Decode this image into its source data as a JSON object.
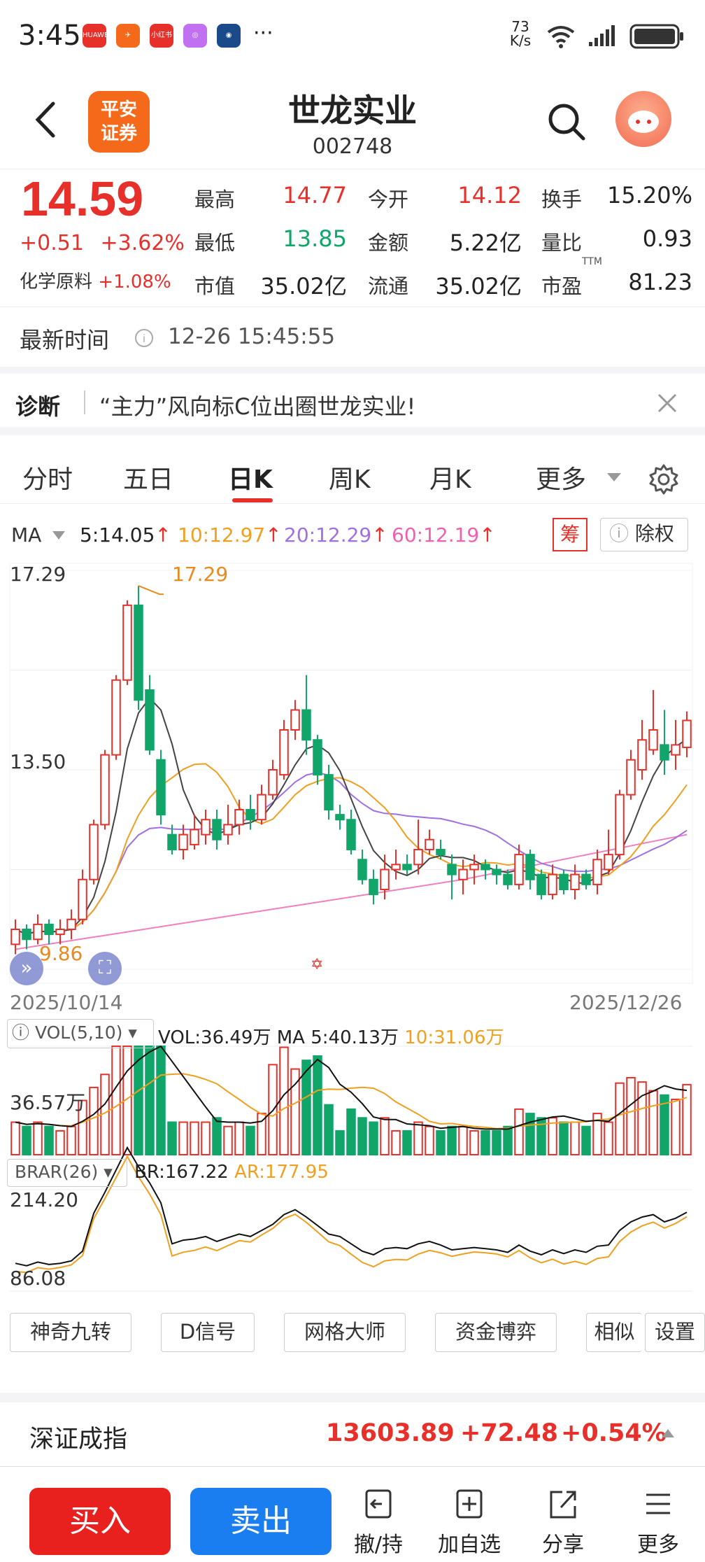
{
  "status_bar": {
    "time": "3:45",
    "net_speed": "73",
    "net_unit": "K/s",
    "app_icons": [
      "HUAWEI",
      "",
      "小红书",
      "",
      "",
      "···"
    ]
  },
  "header": {
    "back_icon": "chevron-left-icon",
    "broker_logo": [
      "平安",
      "证券"
    ],
    "stock_name": "世龙实业",
    "stock_code": "002748",
    "search_icon": "search-icon"
  },
  "quote": {
    "price": "14.59",
    "change": "+0.51",
    "change_pct": "+3.62%",
    "sector": "化学原料",
    "sector_pct": "+1.08%",
    "fields": [
      {
        "label": "最高",
        "value": "14.77",
        "color": "red"
      },
      {
        "label": "今开",
        "value": "14.12",
        "color": "red"
      },
      {
        "label": "换手",
        "value": "15.20%",
        "color": "black"
      },
      {
        "label": "最低",
        "value": "13.85",
        "color": "green"
      },
      {
        "label": "金额",
        "value": "5.22亿",
        "color": "black"
      },
      {
        "label": "量比",
        "value": "0.93",
        "color": "black"
      },
      {
        "label": "市值",
        "value": "35.02亿",
        "color": "black"
      },
      {
        "label": "流通",
        "value": "35.02亿",
        "color": "black"
      },
      {
        "label": "市盈",
        "value": "81.23",
        "color": "black"
      }
    ],
    "ttm": "TTM"
  },
  "latest_time": {
    "label": "最新时间",
    "value": "12-26 15:45:55"
  },
  "diagnose": {
    "label": "诊断",
    "text": "“主力”风向标C位出圈世龙实业!"
  },
  "tabs": [
    "分时",
    "五日",
    "日K",
    "周K",
    "月K",
    "更多"
  ],
  "active_tab": "日K",
  "ma_legend": {
    "label": "MA",
    "ma5": "5:14.05",
    "ma10": "10:12.97",
    "ma20": "20:12.29",
    "ma60": "60:12.19",
    "chip_btn": "筹",
    "exright_btn": "除权"
  },
  "colors": {
    "up": "#e8302b",
    "down": "#10a66a",
    "ma5": "#444444",
    "ma10": "#f0a020",
    "ma20": "#a070e0",
    "ma60": "#f080c0"
  },
  "chart_data": {
    "type": "candlestick",
    "y_top_label": "17.29",
    "y_mid_label": "13.50",
    "high_marker": "17.29",
    "low_marker": "9.86",
    "x_start": "2025/10/14",
    "x_end": "2025/12/26",
    "candles": [
      {
        "o": 10.1,
        "c": 10.4,
        "h": 10.6,
        "l": 9.9
      },
      {
        "o": 10.4,
        "c": 10.2,
        "h": 10.5,
        "l": 10.0
      },
      {
        "o": 10.2,
        "c": 10.5,
        "h": 10.7,
        "l": 10.1
      },
      {
        "o": 10.5,
        "c": 10.3,
        "h": 10.6,
        "l": 10.1
      },
      {
        "o": 10.3,
        "c": 10.4,
        "h": 10.6,
        "l": 10.1
      },
      {
        "o": 10.4,
        "c": 10.6,
        "h": 10.8,
        "l": 10.2
      },
      {
        "o": 10.6,
        "c": 11.4,
        "h": 11.6,
        "l": 10.5
      },
      {
        "o": 11.4,
        "c": 12.5,
        "h": 12.6,
        "l": 11.3
      },
      {
        "o": 12.5,
        "c": 13.9,
        "h": 14.0,
        "l": 12.4
      },
      {
        "o": 13.9,
        "c": 15.4,
        "h": 15.5,
        "l": 13.8
      },
      {
        "o": 15.4,
        "c": 16.9,
        "h": 17.0,
        "l": 15.3
      },
      {
        "o": 16.9,
        "c": 15.0,
        "h": 17.29,
        "l": 14.8
      },
      {
        "o": 15.2,
        "c": 14.0,
        "h": 15.5,
        "l": 13.9
      },
      {
        "o": 13.8,
        "c": 12.7,
        "h": 14.0,
        "l": 12.5
      },
      {
        "o": 12.3,
        "c": 12.0,
        "h": 12.5,
        "l": 11.9
      },
      {
        "o": 12.0,
        "c": 12.3,
        "h": 12.5,
        "l": 11.8
      },
      {
        "o": 12.1,
        "c": 12.4,
        "h": 12.7,
        "l": 12.0
      },
      {
        "o": 12.3,
        "c": 12.6,
        "h": 12.8,
        "l": 12.1
      },
      {
        "o": 12.6,
        "c": 12.2,
        "h": 12.8,
        "l": 12.0
      },
      {
        "o": 12.3,
        "c": 12.5,
        "h": 12.9,
        "l": 12.1
      },
      {
        "o": 12.5,
        "c": 12.8,
        "h": 13.0,
        "l": 12.3
      },
      {
        "o": 12.8,
        "c": 12.6,
        "h": 13.1,
        "l": 12.4
      },
      {
        "o": 12.6,
        "c": 13.1,
        "h": 13.3,
        "l": 12.5
      },
      {
        "o": 13.1,
        "c": 13.6,
        "h": 13.8,
        "l": 13.0
      },
      {
        "o": 13.5,
        "c": 14.4,
        "h": 14.6,
        "l": 13.4
      },
      {
        "o": 14.4,
        "c": 14.8,
        "h": 15.0,
        "l": 14.2
      },
      {
        "o": 14.8,
        "c": 14.2,
        "h": 15.5,
        "l": 13.9
      },
      {
        "o": 14.2,
        "c": 13.5,
        "h": 14.3,
        "l": 13.3
      },
      {
        "o": 13.5,
        "c": 12.8,
        "h": 13.7,
        "l": 12.6
      },
      {
        "o": 12.7,
        "c": 12.6,
        "h": 12.9,
        "l": 12.4
      },
      {
        "o": 12.6,
        "c": 12.0,
        "h": 12.8,
        "l": 11.9
      },
      {
        "o": 11.8,
        "c": 11.4,
        "h": 12.0,
        "l": 11.3
      },
      {
        "o": 11.4,
        "c": 11.1,
        "h": 11.6,
        "l": 10.9
      },
      {
        "o": 11.2,
        "c": 11.6,
        "h": 11.9,
        "l": 11.0
      },
      {
        "o": 11.6,
        "c": 11.7,
        "h": 12.0,
        "l": 11.4
      },
      {
        "o": 11.7,
        "c": 11.6,
        "h": 11.9,
        "l": 11.5
      },
      {
        "o": 11.7,
        "c": 12.0,
        "h": 12.6,
        "l": 11.5
      },
      {
        "o": 12.0,
        "c": 12.2,
        "h": 12.4,
        "l": 11.9
      },
      {
        "o": 12.0,
        "c": 11.9,
        "h": 12.2,
        "l": 11.8
      },
      {
        "o": 11.7,
        "c": 11.5,
        "h": 11.9,
        "l": 11.0
      },
      {
        "o": 11.4,
        "c": 11.6,
        "h": 11.8,
        "l": 11.1
      },
      {
        "o": 11.6,
        "c": 11.7,
        "h": 11.9,
        "l": 11.3
      },
      {
        "o": 11.7,
        "c": 11.6,
        "h": 11.8,
        "l": 11.4
      },
      {
        "o": 11.6,
        "c": 11.5,
        "h": 11.7,
        "l": 11.3
      },
      {
        "o": 11.5,
        "c": 11.3,
        "h": 11.6,
        "l": 11.2
      },
      {
        "o": 11.3,
        "c": 11.9,
        "h": 12.1,
        "l": 11.2
      },
      {
        "o": 11.9,
        "c": 11.4,
        "h": 12.0,
        "l": 11.2
      },
      {
        "o": 11.5,
        "c": 11.1,
        "h": 11.6,
        "l": 11.0
      },
      {
        "o": 11.1,
        "c": 11.5,
        "h": 11.7,
        "l": 11.0
      },
      {
        "o": 11.5,
        "c": 11.2,
        "h": 11.6,
        "l": 11.1
      },
      {
        "o": 11.2,
        "c": 11.5,
        "h": 11.7,
        "l": 11.0
      },
      {
        "o": 11.5,
        "c": 11.3,
        "h": 11.6,
        "l": 11.2
      },
      {
        "o": 11.3,
        "c": 11.8,
        "h": 12.0,
        "l": 11.1
      },
      {
        "o": 11.6,
        "c": 11.9,
        "h": 12.4,
        "l": 11.5
      },
      {
        "o": 11.9,
        "c": 13.1,
        "h": 13.2,
        "l": 11.8
      },
      {
        "o": 13.1,
        "c": 13.8,
        "h": 14.0,
        "l": 13.0
      },
      {
        "o": 13.6,
        "c": 14.2,
        "h": 14.6,
        "l": 13.4
      },
      {
        "o": 14.0,
        "c": 14.4,
        "h": 15.2,
        "l": 13.9
      },
      {
        "o": 14.1,
        "c": 13.8,
        "h": 14.8,
        "l": 13.5
      },
      {
        "o": 13.9,
        "c": 14.1,
        "h": 14.6,
        "l": 13.6
      },
      {
        "o": 14.05,
        "c": 14.59,
        "h": 14.77,
        "l": 13.85
      }
    ]
  },
  "volume": {
    "label": "VOL(5,10)",
    "vol": "VOL:36.49万",
    "ma5": "MA 5:40.13万",
    "ma10": "10:31.06万",
    "y_label": "36.57万"
  },
  "brar": {
    "label": "BRAR(26)",
    "br": "BR:167.22",
    "ar": "AR:177.95",
    "y_top": "214.20",
    "y_bottom": "86.08"
  },
  "indicator_buttons": [
    "神奇九转",
    "D信号",
    "网格大师",
    "资金博弈",
    "相似",
    "设置"
  ],
  "index_row": {
    "name": "深证成指",
    "value": "13603.89",
    "change": "+72.48",
    "pct": "+0.54%"
  },
  "toolbar": {
    "buy": "买入",
    "sell": "卖出",
    "items": [
      {
        "label": "撤/持",
        "icon": "withdraw-icon"
      },
      {
        "label": "加自选",
        "icon": "add-watchlist-icon"
      },
      {
        "label": "分享",
        "icon": "share-icon"
      },
      {
        "label": "更多",
        "icon": "menu-icon"
      }
    ]
  }
}
